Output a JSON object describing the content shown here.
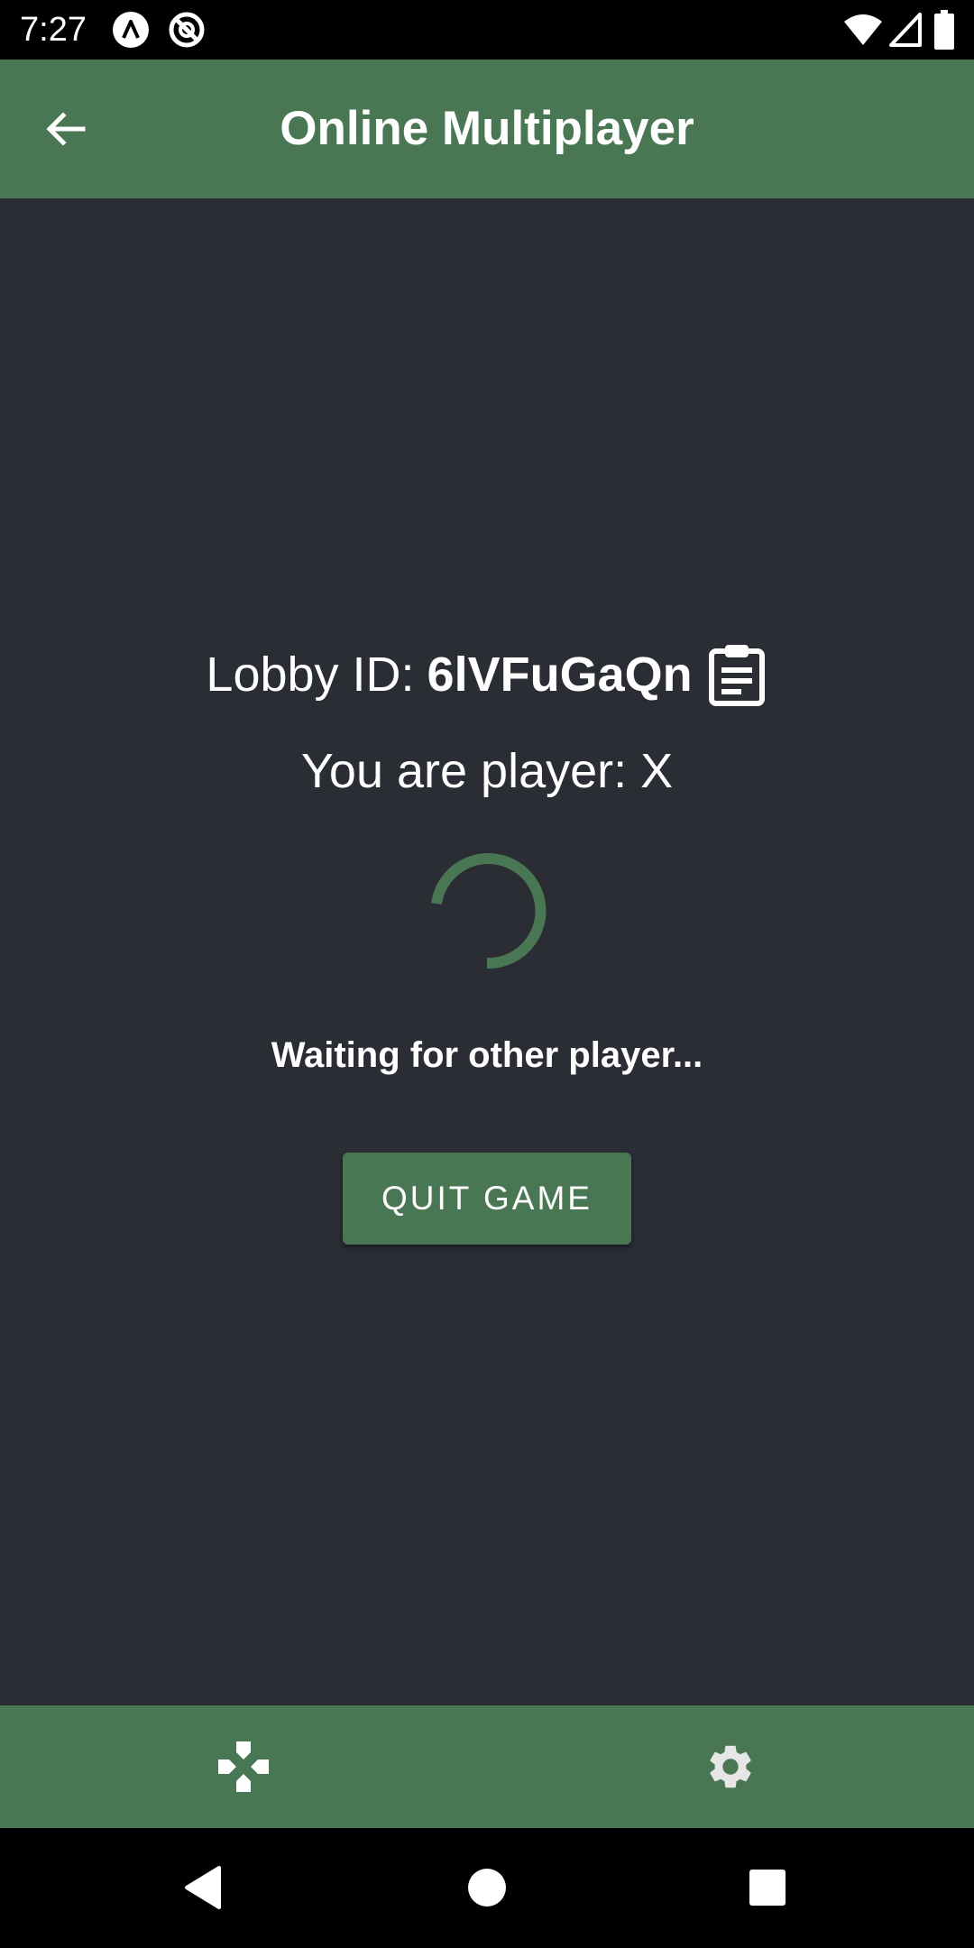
{
  "status_bar": {
    "time": "7:27",
    "icons": [
      "notification-a-icon",
      "notification-b-icon",
      "wifi-icon",
      "signal-icon",
      "battery-icon"
    ]
  },
  "app_bar": {
    "title": "Online Multiplayer",
    "back_icon": "arrow-back-icon"
  },
  "lobby": {
    "label": "Lobby ID:",
    "id": "6lVFuGaQn",
    "copy_icon": "clipboard-icon"
  },
  "player": {
    "text": "You are player: X"
  },
  "status": {
    "waiting_text": "Waiting for other player..."
  },
  "actions": {
    "quit_label": "QUIT GAME"
  },
  "bottom_nav": {
    "items": [
      {
        "icon": "gamepad-icon"
      },
      {
        "icon": "gear-icon"
      }
    ]
  },
  "system_nav": {
    "buttons": [
      "back-triangle-icon",
      "home-circle-icon",
      "recents-square-icon"
    ]
  },
  "colors": {
    "primary": "#4a7753",
    "background": "#2b2d35",
    "text": "#ffffff",
    "system_bar": "#000000"
  }
}
